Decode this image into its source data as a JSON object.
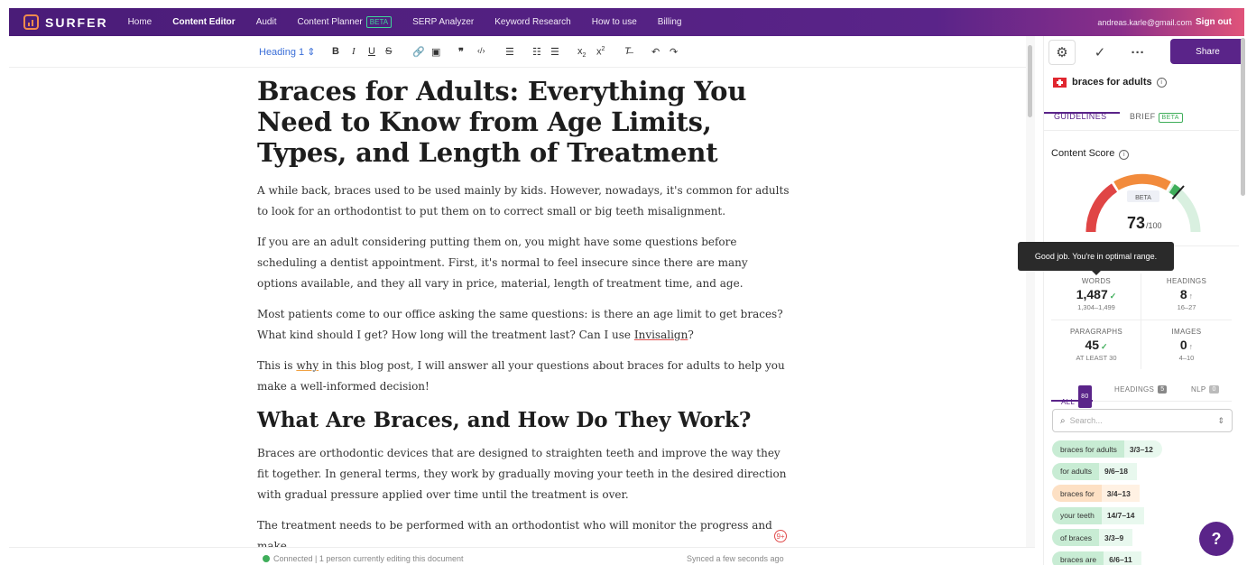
{
  "nav": {
    "brand": "SURFER",
    "items": [
      "Home",
      "Content Editor",
      "Audit",
      "Content Planner",
      "SERP Analyzer",
      "Keyword Research",
      "How to use",
      "Billing"
    ],
    "planner_badge": "BETA",
    "user_email": "andreas.karle@gmail.com",
    "signout": "Sign out"
  },
  "toolbar": {
    "heading_select": "Heading 1",
    "icons": [
      "bold-icon",
      "italic-icon",
      "underline-icon",
      "strikethrough-icon",
      "link-icon",
      "image-icon",
      "quote-icon",
      "code-icon",
      "align-icon",
      "ordered-list-icon",
      "bullet-list-icon",
      "subscript-icon",
      "superscript-icon",
      "clear-format-icon",
      "undo-icon",
      "redo-icon"
    ]
  },
  "doc": {
    "h1": "Braces for Adults: Everything You Need to Know from Age Limits, Types, and Length of Treatment",
    "p1": "A while back, braces used to be used mainly by kids. However, nowadays, it's common for adults to look for an orthodontist to put them on to correct small or big teeth misalignment.",
    "p2": "If you are an adult considering putting them on, you might have some questions before scheduling a dentist appointment. First, it's normal to feel insecure since there are many options available, and they all vary in price, material, length of treatment time, and age.",
    "p3_a": "Most patients come to our office asking the same questions: is there an age limit to get braces? What kind should I get? How long will the treatment last? Can I use ",
    "p3_link": "Invisalign",
    "p3_b": "?",
    "p4_a": "This is ",
    "p4_mark": "why",
    "p4_b": " in this blog post, I will answer all your questions about braces for adults to help you make a well-informed decision!",
    "h2": "What Are Braces, and How Do They Work?",
    "p5": "Braces are orthodontic devices that are designed to straighten teeth and improve the way they fit together. In general terms, they work by gradually moving your teeth in the desired direction with gradual pressure applied over time until the treatment is over.",
    "p6": "The treatment needs to be performed with an orthodontist who will monitor the progress and make",
    "note_count": "9+"
  },
  "status": {
    "left": "Connected | 1 person currently editing this document",
    "right": "Synced a few seconds ago"
  },
  "panel": {
    "share": "Share",
    "keyword": "braces for adults",
    "tab_guidelines": "GUIDELINES",
    "tab_brief": "BRIEF",
    "brief_badge": "BETA",
    "score_title": "Content Score",
    "score_badge": "BETA",
    "score": 73,
    "score_max": "/100",
    "tooltip": "Good job. You're in optimal range.",
    "stats": {
      "words_label": "WORDS",
      "words_val": "1,487",
      "words_range": "1,304–1,499",
      "headings_label": "HEADINGS",
      "headings_val": "8",
      "headings_range": "16–27",
      "paragraphs_label": "PARAGRAPHS",
      "paragraphs_val": "45",
      "paragraphs_range": "AT LEAST 30",
      "images_label": "IMAGES",
      "images_val": "0",
      "images_range": "4–10"
    },
    "term_tabs": {
      "all": "ALL",
      "all_count": "80",
      "headings": "HEADINGS",
      "headings_count": "5",
      "nlp": "NLP",
      "nlp_count": "0"
    },
    "search_placeholder": "Search...",
    "terms": [
      {
        "term": "braces for adults",
        "count": "3/3–12",
        "status": "green"
      },
      {
        "term": "for adults",
        "count": "9/6–18",
        "status": "green"
      },
      {
        "term": "braces for",
        "count": "3/4–13",
        "status": "orange"
      },
      {
        "term": "your teeth",
        "count": "14/7–14",
        "status": "green"
      },
      {
        "term": "of braces",
        "count": "3/3–9",
        "status": "green"
      },
      {
        "term": "braces are",
        "count": "6/6–11",
        "status": "green"
      }
    ],
    "help": "?"
  },
  "colors": {
    "brand": "#5a2489",
    "ok": "#3fae5a",
    "warn": "#f1a243"
  }
}
